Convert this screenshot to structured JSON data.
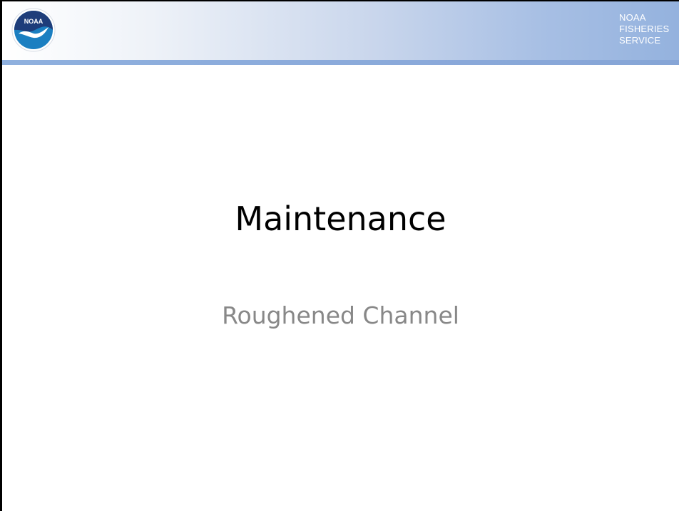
{
  "header": {
    "logo_text": "NOAA",
    "agency_lines": [
      "NOAA",
      "FISHERIES",
      "SERVICE"
    ]
  },
  "slide": {
    "title": "Maintenance",
    "subtitle": "Roughened Channel"
  },
  "colors": {
    "header_gradient_end": "#94b2de",
    "header_rule": "#8aa9da",
    "title": "#000000",
    "subtitle": "#888888",
    "logo_blue": "#1b7fc1",
    "logo_navy": "#1e3d7a"
  },
  "icons": {
    "logo": "noaa-seagull-logo"
  }
}
